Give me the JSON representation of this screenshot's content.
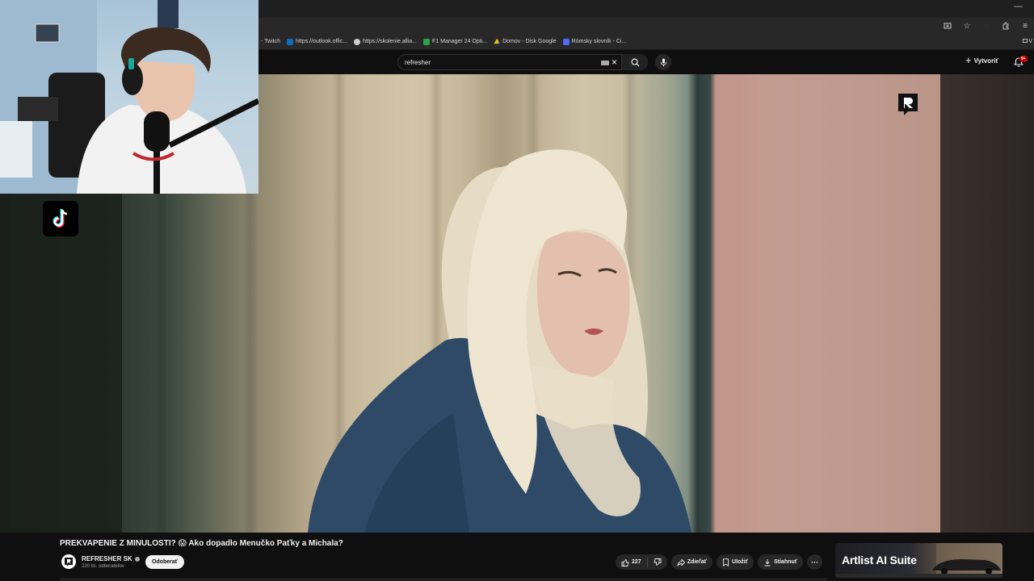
{
  "browser": {
    "bookmarks": [
      {
        "label": "- Twitch",
        "color": "#9146ff"
      },
      {
        "label": "https://outlook.offic...",
        "color": "#0f6cbd"
      },
      {
        "label": "https://skolenie.allia...",
        "color": "#cccccc"
      },
      {
        "label": "F1 Manager 24 Opti...",
        "color": "#2ba24c"
      },
      {
        "label": "Domov - Disk Google",
        "color": "#fbbc04"
      },
      {
        "label": "Rómsky slovník - Ci...",
        "color": "#4a6cf7"
      }
    ],
    "more_bookmarks": "V"
  },
  "header": {
    "search_value": "refresher",
    "create_label": "Vytvoriť",
    "notifications_badge": "9+"
  },
  "video": {
    "title": "PREKVAPENIE Z MINULOSTI? 😱 Ako dopadlo Menučko Paťky a Michala?",
    "channel_name": "REFRESHER SK",
    "subscribers": "220 tis. odberateľov",
    "subscribe_label": "Odoberať",
    "likes": "227",
    "share_label": "Zdieľať",
    "save_label": "Uložiť",
    "download_label": "Stiahnuť",
    "more_label": "···"
  },
  "ad": {
    "text": "Artlist AI Suite"
  },
  "colors": {
    "background": "#0f0f0f",
    "pill": "#272727",
    "accent_red": "#cc0000"
  }
}
